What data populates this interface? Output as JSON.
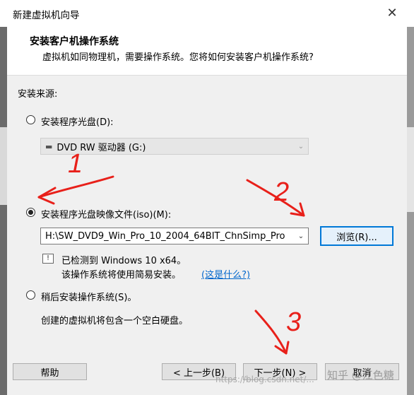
{
  "window": {
    "title": "新建虚拟机向导",
    "close_glyph": "✕"
  },
  "header": {
    "title": "安装客户机操作系统",
    "subtitle": "虚拟机如同物理机，需要操作系统。您将如何安装客户机操作系统?"
  },
  "install_source": {
    "label": "安装来源:",
    "disc_option": {
      "label": "安装程序光盘(D):",
      "selected": false
    },
    "drive_combo": {
      "value": "DVD RW 驱动器 (G:)"
    },
    "iso_option": {
      "label": "安装程序光盘映像文件(iso)(M):",
      "selected": true
    },
    "iso_combo": {
      "value": "H:\\SW_DVD9_Win_Pro_10_2004_64BIT_ChnSimp_Pro"
    },
    "browse_label": "浏览(R)...",
    "detected_text": "已检测到 Windows 10 x64。",
    "easy_install_text": "该操作系统将使用简易安装。",
    "whats_this_link": "(这是什么?)",
    "later_option": {
      "label": "稍后安装操作系统(S)。",
      "selected": false
    },
    "later_desc": "创建的虚拟机将包含一个空白硬盘。"
  },
  "footer": {
    "help_label": "帮助",
    "back_label": "< 上一步(B)",
    "next_label": "下一步(N) >",
    "cancel_label": "取消"
  },
  "annotations": [
    "1",
    "2",
    "3"
  ],
  "watermarks": {
    "csdn": "https://blog.csdn.net/...",
    "zhihu": "知乎 @江色糖"
  },
  "colors": {
    "link": "#0066cc",
    "annotation_red": "#e8201a",
    "focus": "#0078d7"
  }
}
